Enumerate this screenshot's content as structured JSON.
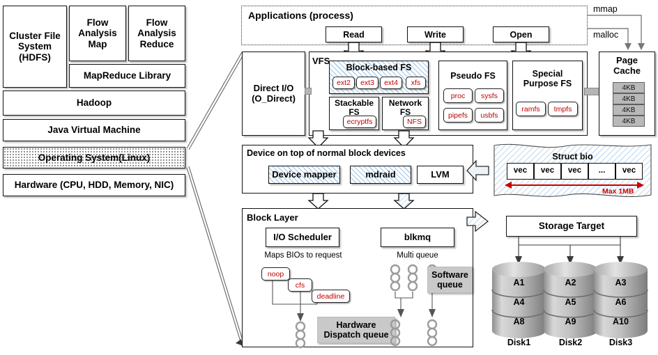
{
  "left_stack": {
    "cluster_fs": "Cluster File\nSystem\n(HDFS)",
    "flow_map": "Flow\nAnalysis\nMap",
    "flow_reduce": "Flow\nAnalysis\nReduce",
    "mapreduce_library": "MapReduce  Library",
    "hadoop": "Hadoop",
    "jvm": "Java Virtual Machine",
    "os": "Operating System(Linux)",
    "hardware": "Hardware  (CPU, HDD, Memory, NIC)"
  },
  "applications": {
    "title": "Applications (process)",
    "syscalls": [
      "Read",
      "Write",
      "Open"
    ],
    "mmap_label": "mmap",
    "malloc_label": "malloc"
  },
  "direct_io": {
    "label": "Direct I/O\n(O_Direct)"
  },
  "vfs": {
    "title": "VFS",
    "block_based": {
      "title": "Block-based  FS",
      "items": [
        "ext2",
        "ext3",
        "ext4",
        "xfs"
      ]
    },
    "stackable": {
      "title": "Stackable\nFS",
      "items": [
        "ecryptfs"
      ]
    },
    "network": {
      "title": "Network\nFS",
      "items": [
        "NFS"
      ]
    },
    "pseudo": {
      "title": "Pseudo FS",
      "items": [
        "proc",
        "sysfs",
        "pipefs",
        "usbfs"
      ]
    },
    "special": {
      "title": "Special\nPurpose FS",
      "items": [
        "ramfs",
        "tmpfs"
      ]
    }
  },
  "page_cache": {
    "title": "Page\nCache",
    "pages": [
      "4KB",
      "4KB",
      "4KB",
      "4KB"
    ]
  },
  "device_layer": {
    "title": "Device on top of normal block devices",
    "items": [
      "Device mapper",
      "mdraid",
      "LVM"
    ]
  },
  "struct_bio": {
    "title": "Struct bio",
    "vecs": [
      "vec",
      "vec",
      "vec",
      "...",
      "vec"
    ],
    "max_label": "Max 1MB",
    "accent_color": "#cc0000"
  },
  "block_layer": {
    "title": "Block Layer",
    "io_scheduler": {
      "title": "I/O Scheduler",
      "caption": "Maps BIOs to request",
      "schedulers": [
        "noop",
        "cfs",
        "deadline"
      ],
      "queue_label": "Hardware\nDispatch queue"
    },
    "blkmq": {
      "title": "blkmq",
      "caption": "Multi queue",
      "queue_label": "Software\nqueue"
    }
  },
  "storage": {
    "title": "Storage  Target",
    "disks": [
      {
        "name": "Disk1",
        "blocks": [
          "A1",
          "A4",
          "A8"
        ]
      },
      {
        "name": "Disk2",
        "blocks": [
          "A2",
          "A5",
          "A9"
        ]
      },
      {
        "name": "Disk3",
        "blocks": [
          "A3",
          "A6",
          "A10"
        ]
      }
    ]
  }
}
